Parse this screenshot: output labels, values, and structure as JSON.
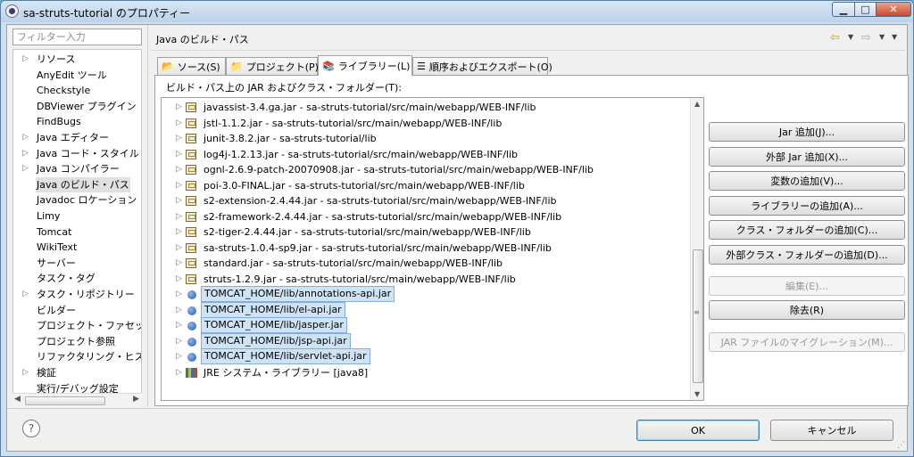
{
  "window": {
    "title": "sa-struts-tutorial のプロパティー"
  },
  "filter": {
    "placeholder": "フィルター入力"
  },
  "nav": {
    "items": [
      {
        "label": "リソース",
        "expandable": true
      },
      {
        "label": "AnyEdit ツール",
        "expandable": false
      },
      {
        "label": "Checkstyle",
        "expandable": false
      },
      {
        "label": "DBViewer プラグイン",
        "expandable": false
      },
      {
        "label": "FindBugs",
        "expandable": false
      },
      {
        "label": "Java エディター",
        "expandable": true
      },
      {
        "label": "Java コード・スタイル",
        "expandable": true
      },
      {
        "label": "Java コンパイラー",
        "expandable": true
      },
      {
        "label": "Java のビルド・パス",
        "expandable": false,
        "selected": true
      },
      {
        "label": "Javadoc ロケーション",
        "expandable": false
      },
      {
        "label": "Limy",
        "expandable": false
      },
      {
        "label": "Tomcat",
        "expandable": false
      },
      {
        "label": "WikiText",
        "expandable": false
      },
      {
        "label": "サーバー",
        "expandable": false
      },
      {
        "label": "タスク・タグ",
        "expandable": false
      },
      {
        "label": "タスク・リポジトリー",
        "expandable": true
      },
      {
        "label": "ビルダー",
        "expandable": false
      },
      {
        "label": "プロジェクト・ファセット",
        "expandable": false
      },
      {
        "label": "プロジェクト参照",
        "expandable": false
      },
      {
        "label": "リファクタリング・ヒスト",
        "expandable": false
      },
      {
        "label": "検証",
        "expandable": true
      },
      {
        "label": "実行/デバッグ設定",
        "expandable": false
      }
    ]
  },
  "page": {
    "title": "Java のビルド・パス",
    "tabs": [
      {
        "label": "ソース(S)"
      },
      {
        "label": "プロジェクト(P)"
      },
      {
        "label": "ライブラリー(L)"
      },
      {
        "label": "順序およびエクスポート(O)"
      }
    ],
    "list_label": "ビルド・パス上の JAR およびクラス・フォルダー(T):",
    "entries": [
      {
        "label": "javassist-3.4.ga.jar - sa-struts-tutorial/src/main/webapp/WEB-INF/lib",
        "kind": "jar"
      },
      {
        "label": "jstl-1.1.2.jar - sa-struts-tutorial/src/main/webapp/WEB-INF/lib",
        "kind": "jar"
      },
      {
        "label": "junit-3.8.2.jar - sa-struts-tutorial/lib",
        "kind": "jar"
      },
      {
        "label": "log4j-1.2.13.jar - sa-struts-tutorial/src/main/webapp/WEB-INF/lib",
        "kind": "jar"
      },
      {
        "label": "ognl-2.6.9-patch-20070908.jar - sa-struts-tutorial/src/main/webapp/WEB-INF/lib",
        "kind": "jar"
      },
      {
        "label": "poi-3.0-FINAL.jar - sa-struts-tutorial/src/main/webapp/WEB-INF/lib",
        "kind": "jar"
      },
      {
        "label": "s2-extension-2.4.44.jar - sa-struts-tutorial/src/main/webapp/WEB-INF/lib",
        "kind": "jar"
      },
      {
        "label": "s2-framework-2.4.44.jar - sa-struts-tutorial/src/main/webapp/WEB-INF/lib",
        "kind": "jar"
      },
      {
        "label": "s2-tiger-2.4.44.jar - sa-struts-tutorial/src/main/webapp/WEB-INF/lib",
        "kind": "jar"
      },
      {
        "label": "sa-struts-1.0.4-sp9.jar - sa-struts-tutorial/src/main/webapp/WEB-INF/lib",
        "kind": "jar"
      },
      {
        "label": "standard.jar - sa-struts-tutorial/src/main/webapp/WEB-INF/lib",
        "kind": "jar"
      },
      {
        "label": "struts-1.2.9.jar - sa-struts-tutorial/src/main/webapp/WEB-INF/lib",
        "kind": "jar"
      },
      {
        "label": "TOMCAT_HOME/lib/annotations-api.jar",
        "kind": "variable",
        "selected": true
      },
      {
        "label": "TOMCAT_HOME/lib/el-api.jar",
        "kind": "variable",
        "selected": true
      },
      {
        "label": "TOMCAT_HOME/lib/jasper.jar",
        "kind": "variable",
        "selected": true
      },
      {
        "label": "TOMCAT_HOME/lib/jsp-api.jar",
        "kind": "variable",
        "selected": true
      },
      {
        "label": "TOMCAT_HOME/lib/servlet-api.jar",
        "kind": "variable",
        "selected": true
      },
      {
        "label": "JRE システム・ライブラリー [java8]",
        "kind": "library"
      }
    ],
    "buttons": [
      {
        "label": "Jar 追加(J)...",
        "enabled": true
      },
      {
        "label": "外部 Jar 追加(X)...",
        "enabled": true
      },
      {
        "label": "変数の追加(V)...",
        "enabled": true
      },
      {
        "label": "ライブラリーの追加(A)...",
        "enabled": true
      },
      {
        "label": "クラス・フォルダーの追加(C)...",
        "enabled": true
      },
      {
        "label": "外部クラス・フォルダーの追加(D)...",
        "enabled": true
      },
      {
        "label": "編集(E)...",
        "enabled": false
      },
      {
        "label": "除去(R)",
        "enabled": true
      },
      {
        "label": "JAR ファイルのマイグレーション(M)...",
        "enabled": false
      }
    ]
  },
  "footer": {
    "ok_label": "OK",
    "cancel_label": "キャンセル",
    "help_glyph": "?"
  },
  "colors": {
    "selection": "#cfe3f7",
    "selection_border": "#84acdd",
    "default_button_border": "#3c7fb1"
  }
}
